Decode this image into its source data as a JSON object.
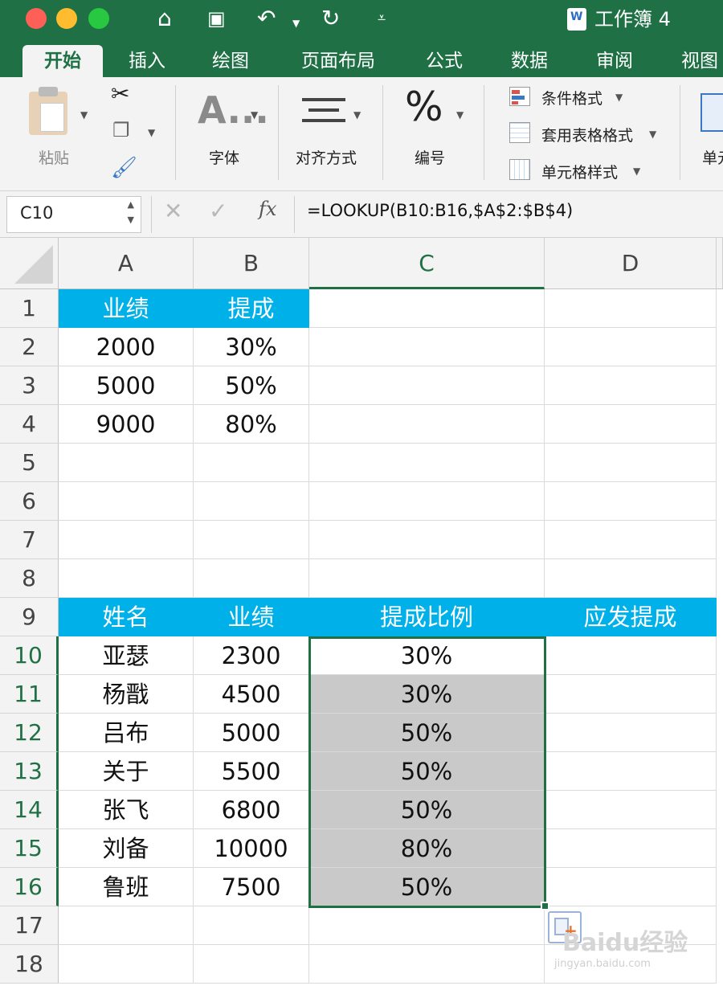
{
  "window": {
    "title": "工作簿 4",
    "colors": {
      "chrome": "#1f7145",
      "header_fill": "#00b0e8",
      "selection_fill": "#c9c9c9"
    },
    "toolbar_icons": [
      "home-icon",
      "save-icon",
      "undo-icon",
      "redo-icon",
      "customize-icon"
    ]
  },
  "tabs": [
    {
      "label": "开始",
      "active": true
    },
    {
      "label": "插入"
    },
    {
      "label": "绘图"
    },
    {
      "label": "页面布局"
    },
    {
      "label": "公式"
    },
    {
      "label": "数据"
    },
    {
      "label": "审阅"
    },
    {
      "label": "视图"
    }
  ],
  "ribbon": {
    "paste": "粘贴",
    "font": "字体",
    "font_icon": "A...",
    "align": "对齐方式",
    "number": "编号",
    "number_icon": "%",
    "cond_format": "条件格式",
    "table_format": "套用表格格式",
    "cell_style": "单元格样式",
    "cells": "单元"
  },
  "formula_bar": {
    "cell_ref": "C10",
    "fx": "fx",
    "formula": "=LOOKUP(B10:B16,$A$2:$B$4)"
  },
  "columns": [
    "A",
    "B",
    "C",
    "D"
  ],
  "rows": [
    "1",
    "2",
    "3",
    "4",
    "5",
    "6",
    "7",
    "8",
    "9",
    "10",
    "11",
    "12",
    "13",
    "14",
    "15",
    "16",
    "17",
    "18"
  ],
  "sheet": {
    "lookup_table": {
      "headers": [
        "业绩",
        "提成"
      ],
      "rows": [
        [
          "2000",
          "30%"
        ],
        [
          "5000",
          "50%"
        ],
        [
          "9000",
          "80%"
        ]
      ]
    },
    "main_table": {
      "headers": [
        "姓名",
        "业绩",
        "提成比例",
        "应发提成"
      ],
      "rows": [
        [
          "亚瑟",
          "2300",
          "30%"
        ],
        [
          "杨戬",
          "4500",
          "30%"
        ],
        [
          "吕布",
          "5000",
          "50%"
        ],
        [
          "关于",
          "5500",
          "50%"
        ],
        [
          "张飞",
          "6800",
          "50%"
        ],
        [
          "刘备",
          "10000",
          "80%"
        ],
        [
          "鲁班",
          "7500",
          "50%"
        ]
      ]
    }
  },
  "watermark": {
    "text": "Baidu经验",
    "sub": "jingyan.baidu.com"
  }
}
